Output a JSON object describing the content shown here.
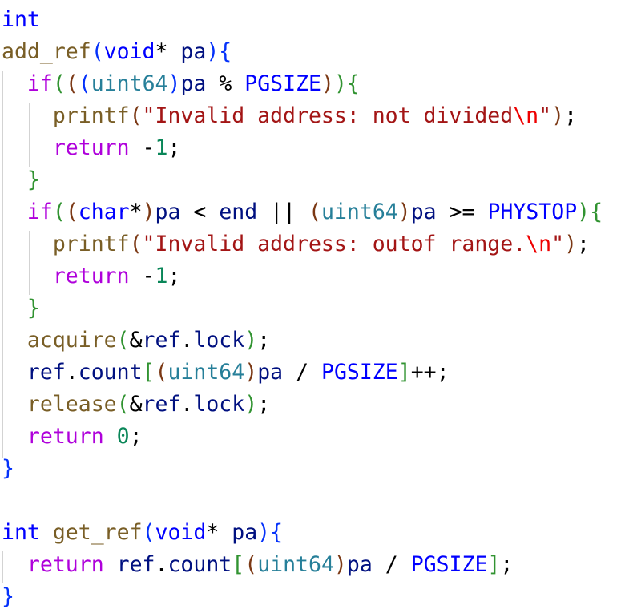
{
  "editor": {
    "language": "c",
    "theme": "light",
    "lines": [
      [
        {
          "t": "int",
          "c": "kw"
        }
      ],
      [
        {
          "t": "add_ref",
          "c": "fn"
        },
        {
          "t": "(",
          "c": "b1"
        },
        {
          "t": "void",
          "c": "kw"
        },
        {
          "t": "* ",
          "c": ""
        },
        {
          "t": "pa",
          "c": "var"
        },
        {
          "t": ")",
          "c": "b1"
        },
        {
          "t": "{",
          "c": "b1"
        }
      ],
      [
        {
          "t": "  ",
          "c": ""
        },
        {
          "t": "if",
          "c": "ctl"
        },
        {
          "t": "(",
          "c": "b2"
        },
        {
          "t": "(",
          "c": "b3"
        },
        {
          "t": "(",
          "c": "b1"
        },
        {
          "t": "uint64",
          "c": "typ"
        },
        {
          "t": ")",
          "c": "b1"
        },
        {
          "t": "pa",
          "c": "var"
        },
        {
          "t": " % ",
          "c": ""
        },
        {
          "t": "PGSIZE",
          "c": "mac"
        },
        {
          "t": ")",
          "c": "b3"
        },
        {
          "t": ")",
          "c": "b2"
        },
        {
          "t": "{",
          "c": "b2"
        }
      ],
      [
        {
          "t": "    ",
          "c": ""
        },
        {
          "t": "printf",
          "c": "fn"
        },
        {
          "t": "(",
          "c": "b3"
        },
        {
          "t": "\"Invalid address: not divided",
          "c": "str"
        },
        {
          "t": "\\n",
          "c": "esc"
        },
        {
          "t": "\"",
          "c": "str"
        },
        {
          "t": ")",
          "c": "b3"
        },
        {
          "t": ";",
          "c": ""
        }
      ],
      [
        {
          "t": "    ",
          "c": ""
        },
        {
          "t": "return",
          "c": "ctl"
        },
        {
          "t": " -",
          "c": ""
        },
        {
          "t": "1",
          "c": "num"
        },
        {
          "t": ";",
          "c": ""
        }
      ],
      [
        {
          "t": "  ",
          "c": ""
        },
        {
          "t": "}",
          "c": "b2"
        }
      ],
      [
        {
          "t": "  ",
          "c": ""
        },
        {
          "t": "if",
          "c": "ctl"
        },
        {
          "t": "(",
          "c": "b2"
        },
        {
          "t": "(",
          "c": "b3"
        },
        {
          "t": "char",
          "c": "kw"
        },
        {
          "t": "*",
          "c": ""
        },
        {
          "t": ")",
          "c": "b3"
        },
        {
          "t": "pa",
          "c": "var"
        },
        {
          "t": " < ",
          "c": ""
        },
        {
          "t": "end",
          "c": "var"
        },
        {
          "t": " || ",
          "c": ""
        },
        {
          "t": "(",
          "c": "b3"
        },
        {
          "t": "uint64",
          "c": "typ"
        },
        {
          "t": ")",
          "c": "b3"
        },
        {
          "t": "pa",
          "c": "var"
        },
        {
          "t": " >= ",
          "c": ""
        },
        {
          "t": "PHYSTOP",
          "c": "mac"
        },
        {
          "t": ")",
          "c": "b2"
        },
        {
          "t": "{",
          "c": "b2"
        }
      ],
      [
        {
          "t": "    ",
          "c": ""
        },
        {
          "t": "printf",
          "c": "fn"
        },
        {
          "t": "(",
          "c": "b3"
        },
        {
          "t": "\"Invalid address: outof range.",
          "c": "str"
        },
        {
          "t": "\\n",
          "c": "esc"
        },
        {
          "t": "\"",
          "c": "str"
        },
        {
          "t": ")",
          "c": "b3"
        },
        {
          "t": ";",
          "c": ""
        }
      ],
      [
        {
          "t": "    ",
          "c": ""
        },
        {
          "t": "return",
          "c": "ctl"
        },
        {
          "t": " -",
          "c": ""
        },
        {
          "t": "1",
          "c": "num"
        },
        {
          "t": ";",
          "c": ""
        }
      ],
      [
        {
          "t": "  ",
          "c": ""
        },
        {
          "t": "}",
          "c": "b2"
        }
      ],
      [
        {
          "t": "  ",
          "c": ""
        },
        {
          "t": "acquire",
          "c": "fn"
        },
        {
          "t": "(",
          "c": "b2"
        },
        {
          "t": "&",
          "c": ""
        },
        {
          "t": "ref",
          "c": "var"
        },
        {
          "t": ".",
          "c": ""
        },
        {
          "t": "lock",
          "c": "var"
        },
        {
          "t": ")",
          "c": "b2"
        },
        {
          "t": ";",
          "c": ""
        }
      ],
      [
        {
          "t": "  ",
          "c": ""
        },
        {
          "t": "ref",
          "c": "var"
        },
        {
          "t": ".",
          "c": ""
        },
        {
          "t": "count",
          "c": "var"
        },
        {
          "t": "[",
          "c": "b2"
        },
        {
          "t": "(",
          "c": "b3"
        },
        {
          "t": "uint64",
          "c": "typ"
        },
        {
          "t": ")",
          "c": "b3"
        },
        {
          "t": "pa",
          "c": "var"
        },
        {
          "t": " / ",
          "c": ""
        },
        {
          "t": "PGSIZE",
          "c": "mac"
        },
        {
          "t": "]",
          "c": "b2"
        },
        {
          "t": "++;",
          "c": ""
        }
      ],
      [
        {
          "t": "  ",
          "c": ""
        },
        {
          "t": "release",
          "c": "fn"
        },
        {
          "t": "(",
          "c": "b2"
        },
        {
          "t": "&",
          "c": ""
        },
        {
          "t": "ref",
          "c": "var"
        },
        {
          "t": ".",
          "c": ""
        },
        {
          "t": "lock",
          "c": "var"
        },
        {
          "t": ")",
          "c": "b2"
        },
        {
          "t": ";",
          "c": ""
        }
      ],
      [
        {
          "t": "  ",
          "c": ""
        },
        {
          "t": "return",
          "c": "ctl"
        },
        {
          "t": " ",
          "c": ""
        },
        {
          "t": "0",
          "c": "num"
        },
        {
          "t": ";",
          "c": ""
        }
      ],
      [
        {
          "t": "}",
          "c": "b1"
        }
      ],
      [],
      [
        {
          "t": "int",
          "c": "kw"
        },
        {
          "t": " ",
          "c": ""
        },
        {
          "t": "get_ref",
          "c": "fn"
        },
        {
          "t": "(",
          "c": "b1"
        },
        {
          "t": "void",
          "c": "kw"
        },
        {
          "t": "* ",
          "c": ""
        },
        {
          "t": "pa",
          "c": "var"
        },
        {
          "t": ")",
          "c": "b1"
        },
        {
          "t": "{",
          "c": "b1"
        }
      ],
      [
        {
          "t": "  ",
          "c": ""
        },
        {
          "t": "return",
          "c": "ctl"
        },
        {
          "t": " ",
          "c": ""
        },
        {
          "t": "ref",
          "c": "var"
        },
        {
          "t": ".",
          "c": ""
        },
        {
          "t": "count",
          "c": "var"
        },
        {
          "t": "[",
          "c": "b2"
        },
        {
          "t": "(",
          "c": "b3"
        },
        {
          "t": "uint64",
          "c": "typ"
        },
        {
          "t": ")",
          "c": "b3"
        },
        {
          "t": "pa",
          "c": "var"
        },
        {
          "t": " / ",
          "c": ""
        },
        {
          "t": "PGSIZE",
          "c": "mac"
        },
        {
          "t": "]",
          "c": "b2"
        },
        {
          "t": ";",
          "c": ""
        }
      ],
      [
        {
          "t": "}",
          "c": "b1"
        }
      ]
    ]
  }
}
